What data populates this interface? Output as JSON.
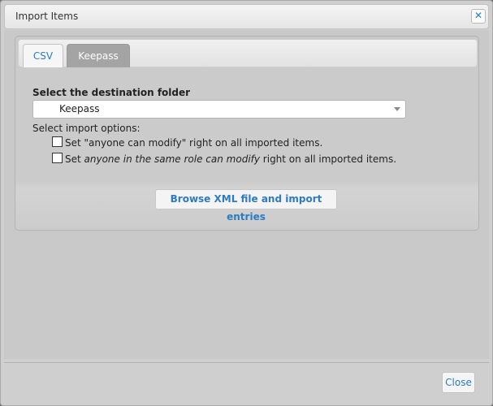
{
  "dialog": {
    "title": "Import Items",
    "close_icon": "close-icon"
  },
  "tabs": [
    {
      "label": "CSV",
      "active": false
    },
    {
      "label": "Keepass",
      "active": true
    }
  ],
  "keepass": {
    "destination_label": "Select the destination folder",
    "folder_value": "Keepass",
    "options_label": "Select import options:",
    "option1": {
      "prefix": "Set \"anyone can modify\" right on all imported items.",
      "checked": false
    },
    "option2": {
      "prefix": "Set ",
      "emphasis": "anyone in the same role can modify",
      "suffix": " right on all imported items.",
      "checked": false
    },
    "browse_label": "Browse XML file and import entries"
  },
  "footer": {
    "close_label": "Close"
  },
  "colors": {
    "link_blue": "#2c7bc4",
    "active_tab": "#a4a4a4"
  }
}
